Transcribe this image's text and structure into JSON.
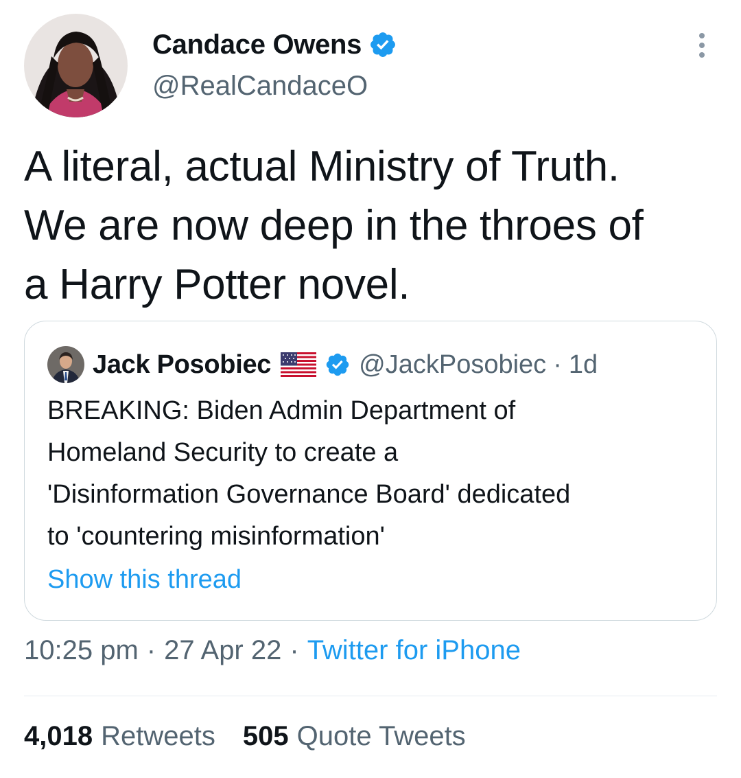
{
  "author": {
    "name": "Candace Owens",
    "handle": "@RealCandaceO",
    "verified": true,
    "avatar_icon": "profile-photo"
  },
  "tweet": {
    "text_lines": [
      "A literal, actual Ministry of Truth.",
      "We are now deep in the throes of",
      "a Harry Potter novel."
    ]
  },
  "quoted_tweet": {
    "name": "Jack Posobiec",
    "flag_icon": "us-flag-icon",
    "verified": true,
    "handle": "@JackPosobiec",
    "separator": "·",
    "time": "1d",
    "text_lines": [
      "BREAKING: Biden Admin Department of",
      "Homeland Security to create a",
      "'Disinformation Governance Board' dedicated",
      "to 'countering misinformation'"
    ],
    "show_thread": "Show this thread"
  },
  "meta": {
    "time": "10:25 pm",
    "separator": "·",
    "date": "27 Apr 22",
    "source": "Twitter for iPhone"
  },
  "stats": {
    "retweets_count": "4,018",
    "retweets_label": "Retweets",
    "quotes_count": "505",
    "quotes_label": "Quote Tweets"
  },
  "colors": {
    "text": "#0f1419",
    "secondary": "#536471",
    "link": "#1d9bf0",
    "verified": "#1d9bf0",
    "border": "#cfd9de"
  }
}
